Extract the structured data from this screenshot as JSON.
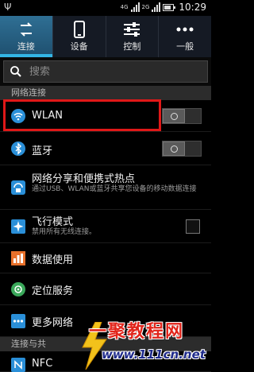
{
  "status_bar": {
    "network_1": "4G",
    "network_2": "2G",
    "battery_level": 0.8,
    "time": "10:29"
  },
  "tabs": [
    {
      "label": "连接",
      "icon": "arrows-icon",
      "active": true
    },
    {
      "label": "设备",
      "icon": "phone-icon",
      "active": false
    },
    {
      "label": "控制",
      "icon": "sliders-icon",
      "active": false
    },
    {
      "label": "一般",
      "icon": "more-icon",
      "active": false
    }
  ],
  "search": {
    "placeholder": "搜索",
    "value": ""
  },
  "sections": {
    "network": "网络连接",
    "connect_share": "连接与共"
  },
  "items": {
    "wlan": {
      "title": "WLAN",
      "toggle": "off"
    },
    "bluetooth": {
      "title": "蓝牙",
      "toggle": "off"
    },
    "tethering": {
      "title": "网络分享和便携式热点",
      "subtitle": "通过USB、WLAN或蓝牙共享您设备的移动数据连接"
    },
    "airplane": {
      "title": "飞行模式",
      "subtitle": "禁用所有无线连接。",
      "checked": false
    },
    "data_usage": {
      "title": "数据使用"
    },
    "location": {
      "title": "定位服务"
    },
    "more_networks": {
      "title": "更多网络"
    },
    "nfc": {
      "title": "NFC"
    }
  },
  "watermark": {
    "title": "一聚教程网",
    "url": "www.111cn.net"
  },
  "colors": {
    "accent": "#33b5e5",
    "highlight": "#e01818"
  }
}
